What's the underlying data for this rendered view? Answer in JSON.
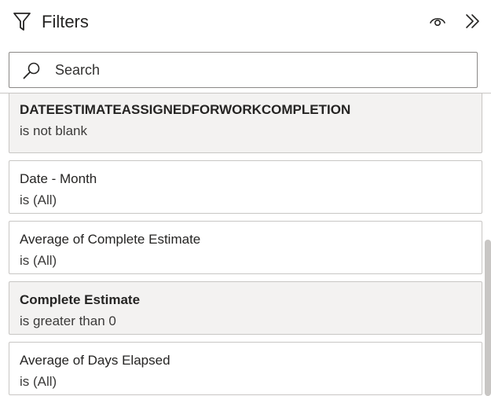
{
  "header": {
    "title": "Filters",
    "icons": {
      "filter": "filter-funnel-icon",
      "visibility": "eye-icon",
      "collapse": "double-chevron-right-icon"
    }
  },
  "search": {
    "placeholder": "Search",
    "value": "",
    "icon": "search-icon"
  },
  "filters": [
    {
      "name": "DATEESTIMATEASSIGNEDFORWORKCOMPLETION",
      "condition": "is not blank",
      "active": true
    },
    {
      "name": "Date - Month",
      "condition": "is (All)",
      "active": false
    },
    {
      "name": "Average of Complete Estimate",
      "condition": "is (All)",
      "active": false
    },
    {
      "name": "Complete Estimate",
      "condition": "is greater than 0",
      "active": true
    },
    {
      "name": "Average of Days Elapsed",
      "condition": "is (All)",
      "active": false
    }
  ],
  "colors": {
    "active_card_bg": "#f3f2f1",
    "card_border": "#c8c6c4",
    "text": "#252423"
  }
}
